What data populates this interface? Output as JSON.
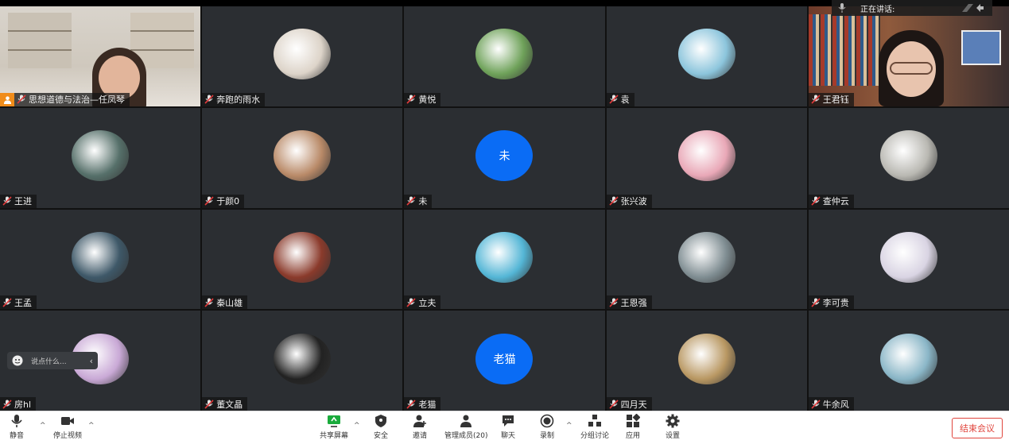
{
  "speaking_banner": {
    "label": "正在讲话:"
  },
  "participants": [
    {
      "name": "思想道德与法治—任凤琴",
      "kind": "video",
      "scene": "teacher"
    },
    {
      "name": "奔跑的雨水",
      "kind": "avatar",
      "color": "#ddd4c9"
    },
    {
      "name": "黄悦",
      "kind": "avatar",
      "color": "#6fa25a"
    },
    {
      "name": "袁",
      "kind": "avatar",
      "color": "#8cc5dc"
    },
    {
      "name": "王君钰",
      "kind": "video",
      "scene": "library"
    },
    {
      "name": "王进",
      "kind": "avatar",
      "color": "#56706a"
    },
    {
      "name": "于颜0",
      "kind": "avatar",
      "color": "#b98a68"
    },
    {
      "name": "未",
      "kind": "text",
      "avatar_text": "未"
    },
    {
      "name": "张兴波",
      "kind": "avatar",
      "color": "#e9a8b7"
    },
    {
      "name": "查仲云",
      "kind": "avatar",
      "color": "#b9b8b2"
    },
    {
      "name": "王孟",
      "kind": "avatar",
      "color": "#3e5868"
    },
    {
      "name": "秦山雄",
      "kind": "avatar",
      "color": "#8a3a2b"
    },
    {
      "name": "立夫",
      "kind": "avatar",
      "color": "#54b6d6"
    },
    {
      "name": "王恩强",
      "kind": "avatar",
      "color": "#7f8d92"
    },
    {
      "name": "李可贵",
      "kind": "avatar",
      "color": "#d9d4e3"
    },
    {
      "name": "房hl",
      "kind": "avatar",
      "color": "#c9a9d6"
    },
    {
      "name": "董文晶",
      "kind": "avatar",
      "color": "#222222"
    },
    {
      "name": "老猫",
      "kind": "text",
      "avatar_text": "老猫"
    },
    {
      "name": "四月天",
      "kind": "avatar",
      "color": "#b99863"
    },
    {
      "name": "牛余风",
      "kind": "avatar",
      "color": "#8ab6c7"
    }
  ],
  "chat_popup": {
    "placeholder": "说点什么..."
  },
  "toolbar": {
    "mute": "静音",
    "stop_video": "停止视频",
    "share_screen": "共享屏幕",
    "security": "安全",
    "invite": "邀请",
    "manage_members": "管理成员(20)",
    "chat": "聊天",
    "record": "录制",
    "breakout": "分组讨论",
    "apps": "应用",
    "settings": "设置",
    "end_meeting": "结束会议"
  },
  "colors": {
    "accent_blue": "#0a6cf5",
    "end_red": "#e0453d",
    "share_green": "#1aab3c"
  }
}
